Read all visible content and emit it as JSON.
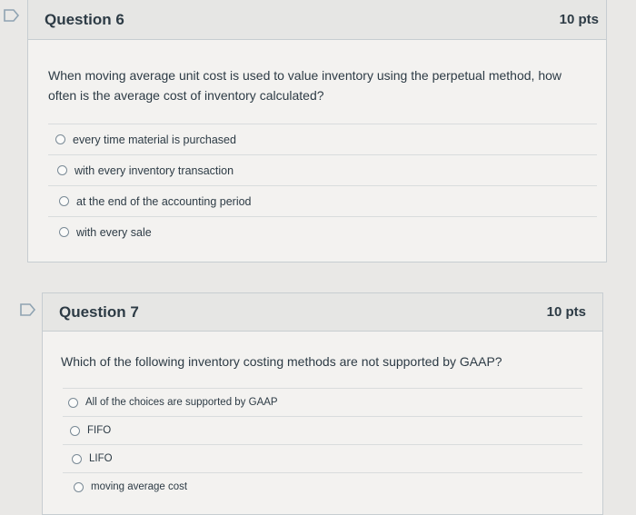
{
  "q6": {
    "title": "Question 6",
    "points": "10 pts",
    "text": "When moving average unit cost is used to value inventory using the perpetual method, how often is the average cost of inventory calculated?",
    "answers": [
      "every time material is purchased",
      "with every inventory transaction",
      "at the end of the accounting period",
      "with every sale"
    ]
  },
  "q7": {
    "title": "Question 7",
    "points": "10 pts",
    "text": "Which of the following inventory costing methods are not supported by GAAP?",
    "answers": [
      "All of the choices are supported by GAAP",
      "FIFO",
      "LIFO",
      "moving average cost"
    ]
  },
  "colors": {
    "flag": "#8fa3b2",
    "accent_text": "#2d3b45"
  },
  "icons": {
    "flag": "flag-question-icon",
    "radio": "radio-button-icon"
  }
}
